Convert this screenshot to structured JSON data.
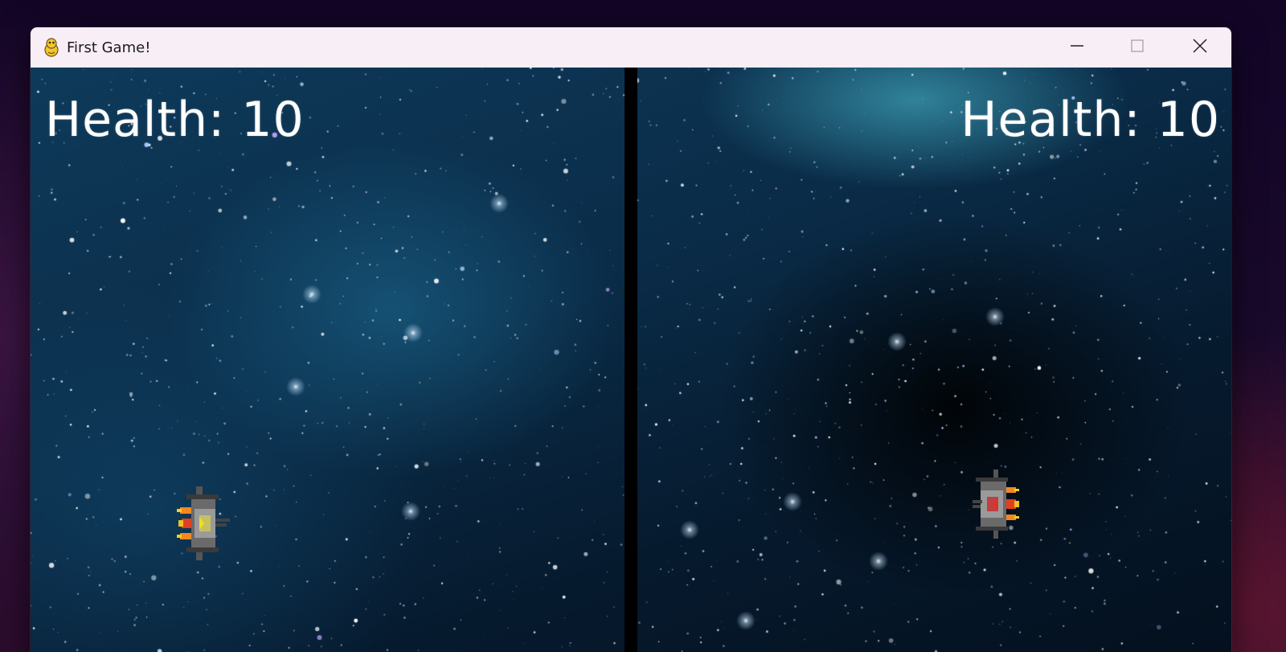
{
  "window": {
    "title": "First Game!",
    "app_icon": "python-snake-icon",
    "controls": {
      "minimize_icon": "minimize-icon",
      "maximize_icon": "maximize-icon",
      "close_icon": "close-icon"
    }
  },
  "game": {
    "left_player": {
      "health_text": "Health: 10",
      "ship_color": "yellow",
      "ship_icon": "yellow-spaceship-icon"
    },
    "right_player": {
      "health_text": "Health: 10",
      "ship_color": "red",
      "ship_icon": "red-spaceship-icon"
    },
    "background": "space-starfield",
    "divider_color": "#000000"
  }
}
